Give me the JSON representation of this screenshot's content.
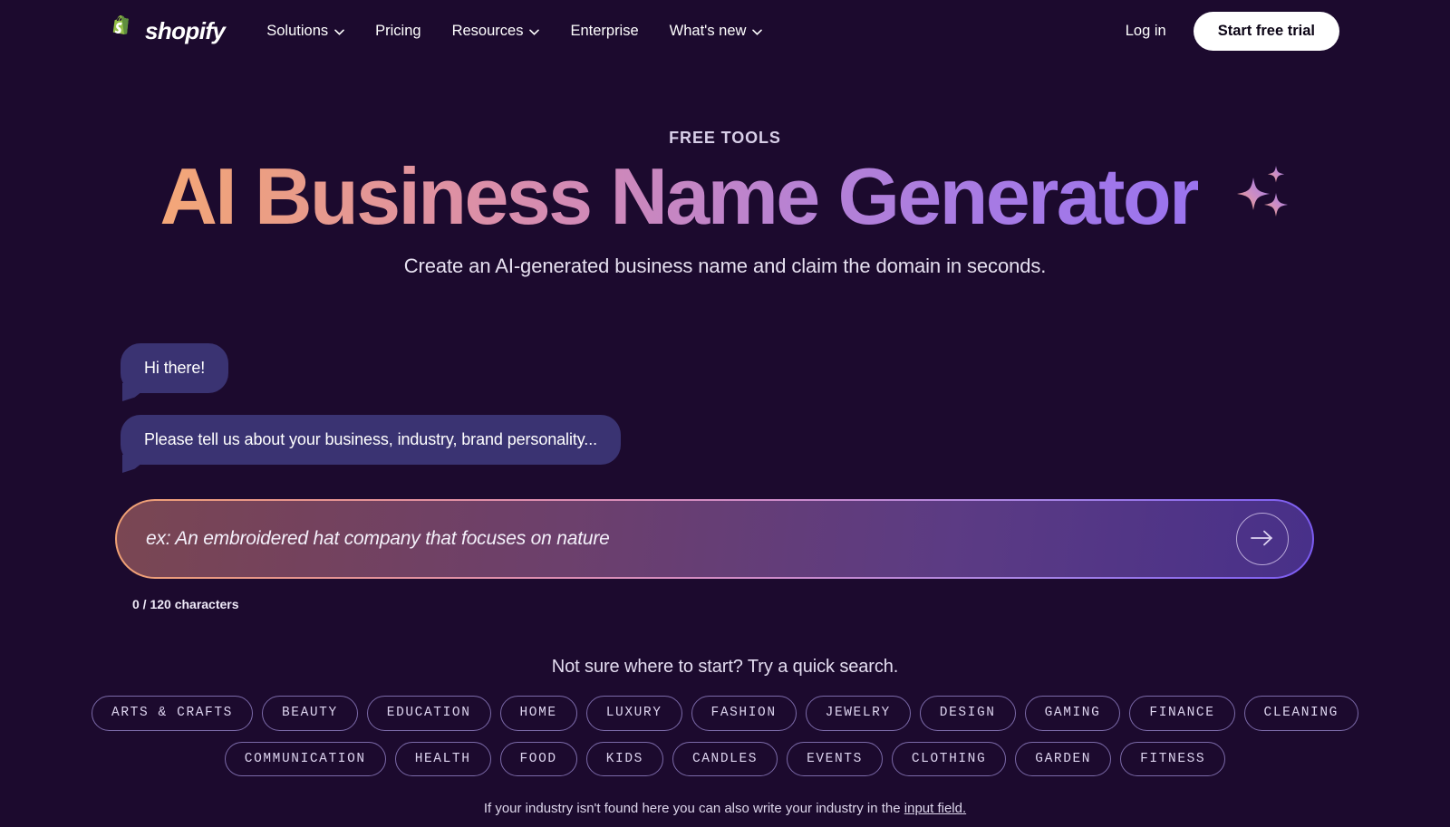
{
  "brand": {
    "name": "shopify",
    "logo_icon": "shopify-bag-icon",
    "logo_color": "#95bf47"
  },
  "header": {
    "nav": [
      {
        "label": "Solutions",
        "has_dropdown": true
      },
      {
        "label": "Pricing",
        "has_dropdown": false
      },
      {
        "label": "Resources",
        "has_dropdown": true
      },
      {
        "label": "Enterprise",
        "has_dropdown": false
      },
      {
        "label": "What's new",
        "has_dropdown": true
      }
    ],
    "login_label": "Log in",
    "trial_label": "Start free trial"
  },
  "hero": {
    "eyebrow": "FREE TOOLS",
    "title": "AI Business Name Generator",
    "sparkle_icon": "sparkles-icon",
    "subtitle": "Create an AI-generated business name and claim the domain in seconds.",
    "title_gradient_start": "#f5a878",
    "title_gradient_mid": "#d089b8",
    "title_gradient_end": "#9a73ef"
  },
  "chat": {
    "messages": [
      {
        "text": "Hi there!"
      },
      {
        "text": "Please tell us about your business, industry, brand personality..."
      }
    ],
    "bubble_color": "#3a3372"
  },
  "input": {
    "value": "",
    "placeholder": "ex: An embroidered hat company that focuses on nature",
    "submit_icon": "arrow-right-icon",
    "counter": "0 / 120 characters",
    "max_characters": 120,
    "used_characters": 0,
    "border_gradient_start": "#f0a173",
    "border_gradient_end": "#7b5bf2"
  },
  "quick_search": {
    "prompt": "Not sure where to start? Try a quick search.",
    "row1": [
      "ARTS & CRAFTS",
      "BEAUTY",
      "EDUCATION",
      "HOME",
      "LUXURY",
      "FASHION",
      "JEWELRY",
      "DESIGN",
      "GAMING",
      "FINANCE",
      "CLEANING"
    ],
    "row2": [
      "COMMUNICATION",
      "HEALTH",
      "FOOD",
      "KIDS",
      "CANDLES",
      "EVENTS",
      "CLOTHING",
      "GARDEN",
      "FITNESS"
    ]
  },
  "footnote": {
    "text": "If your industry isn't found here you can also write your industry in the ",
    "link": "input field."
  }
}
